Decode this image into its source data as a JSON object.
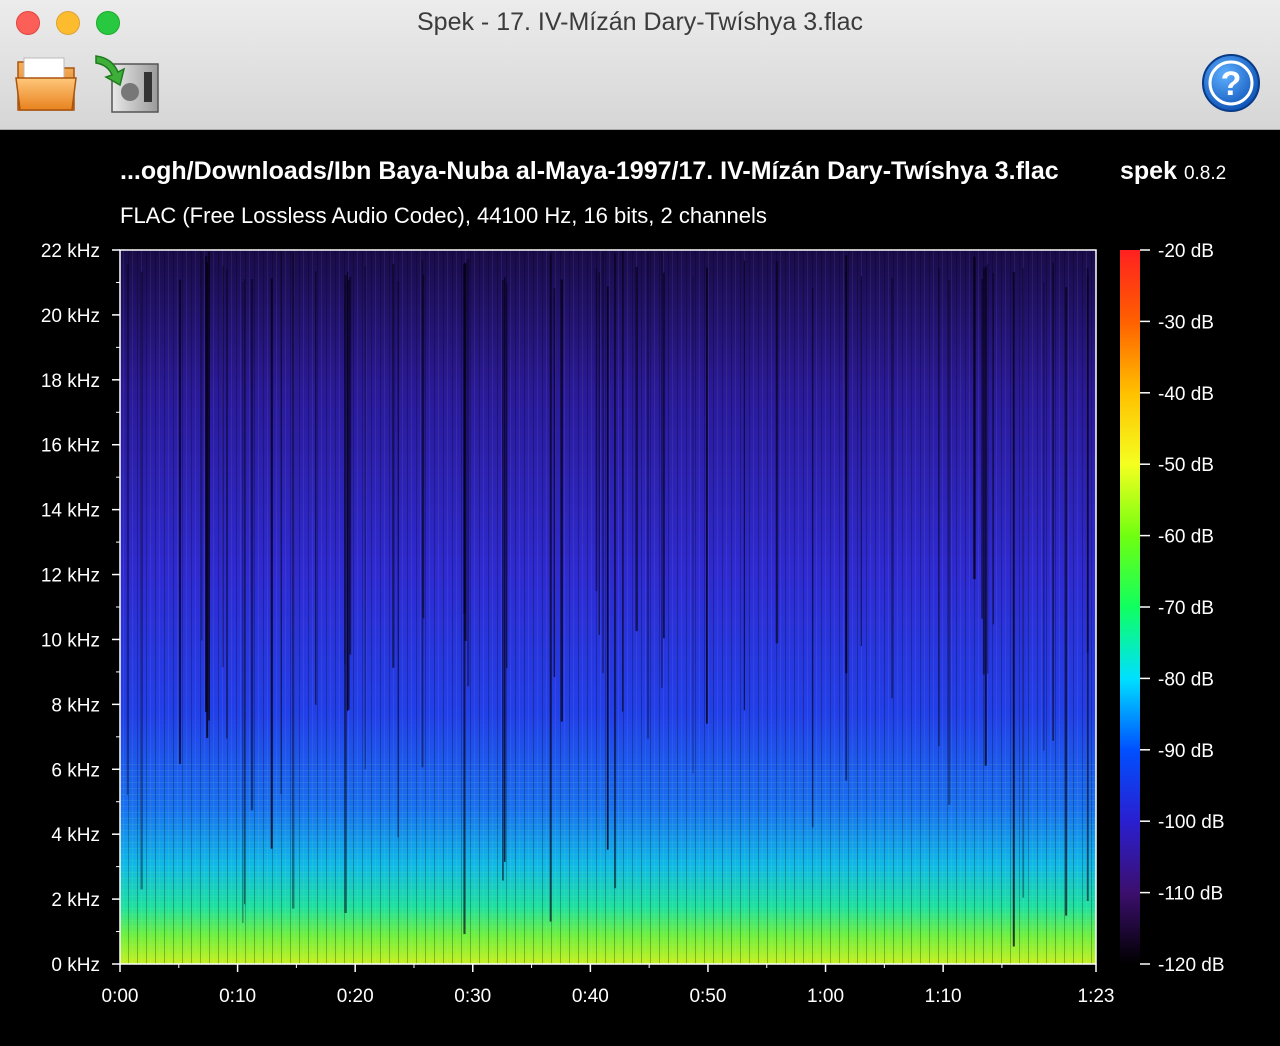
{
  "window": {
    "title": "Spek - 17. IV-Mízán Dary-Twíshya 3.flac"
  },
  "toolbar": {
    "open_icon": "folder-icon",
    "export_icon": "save-export-icon",
    "help_icon": "help-icon"
  },
  "header": {
    "file_path": "...ogh/Downloads/Ibn Baya-Nuba al-Maya-1997/17. IV-Mízán Dary-Twíshya 3.flac",
    "app_name": "spek",
    "app_version": "0.8.2",
    "audio_info": "FLAC (Free Lossless Audio Codec), 44100 Hz, 16 bits, 2 channels"
  },
  "spectrogram": {
    "freq_ticks": [
      "22 kHz",
      "20 kHz",
      "18 kHz",
      "16 kHz",
      "14 kHz",
      "12 kHz",
      "10 kHz",
      "8 kHz",
      "6 kHz",
      "4 kHz",
      "2 kHz",
      "0 kHz"
    ],
    "time_ticks": [
      "0:00",
      "0:10",
      "0:20",
      "0:30",
      "0:40",
      "0:50",
      "1:00",
      "1:10",
      "1:23"
    ],
    "db_ticks": [
      "-20 dB",
      "-30 dB",
      "-40 dB",
      "-50 dB",
      "-60 dB",
      "-70 dB",
      "-80 dB",
      "-90 dB",
      "-100 dB",
      "-110 dB",
      "-120 dB"
    ],
    "duration_seconds": 83,
    "max_freq_khz": 22,
    "db_range": [
      -120,
      -20
    ]
  }
}
